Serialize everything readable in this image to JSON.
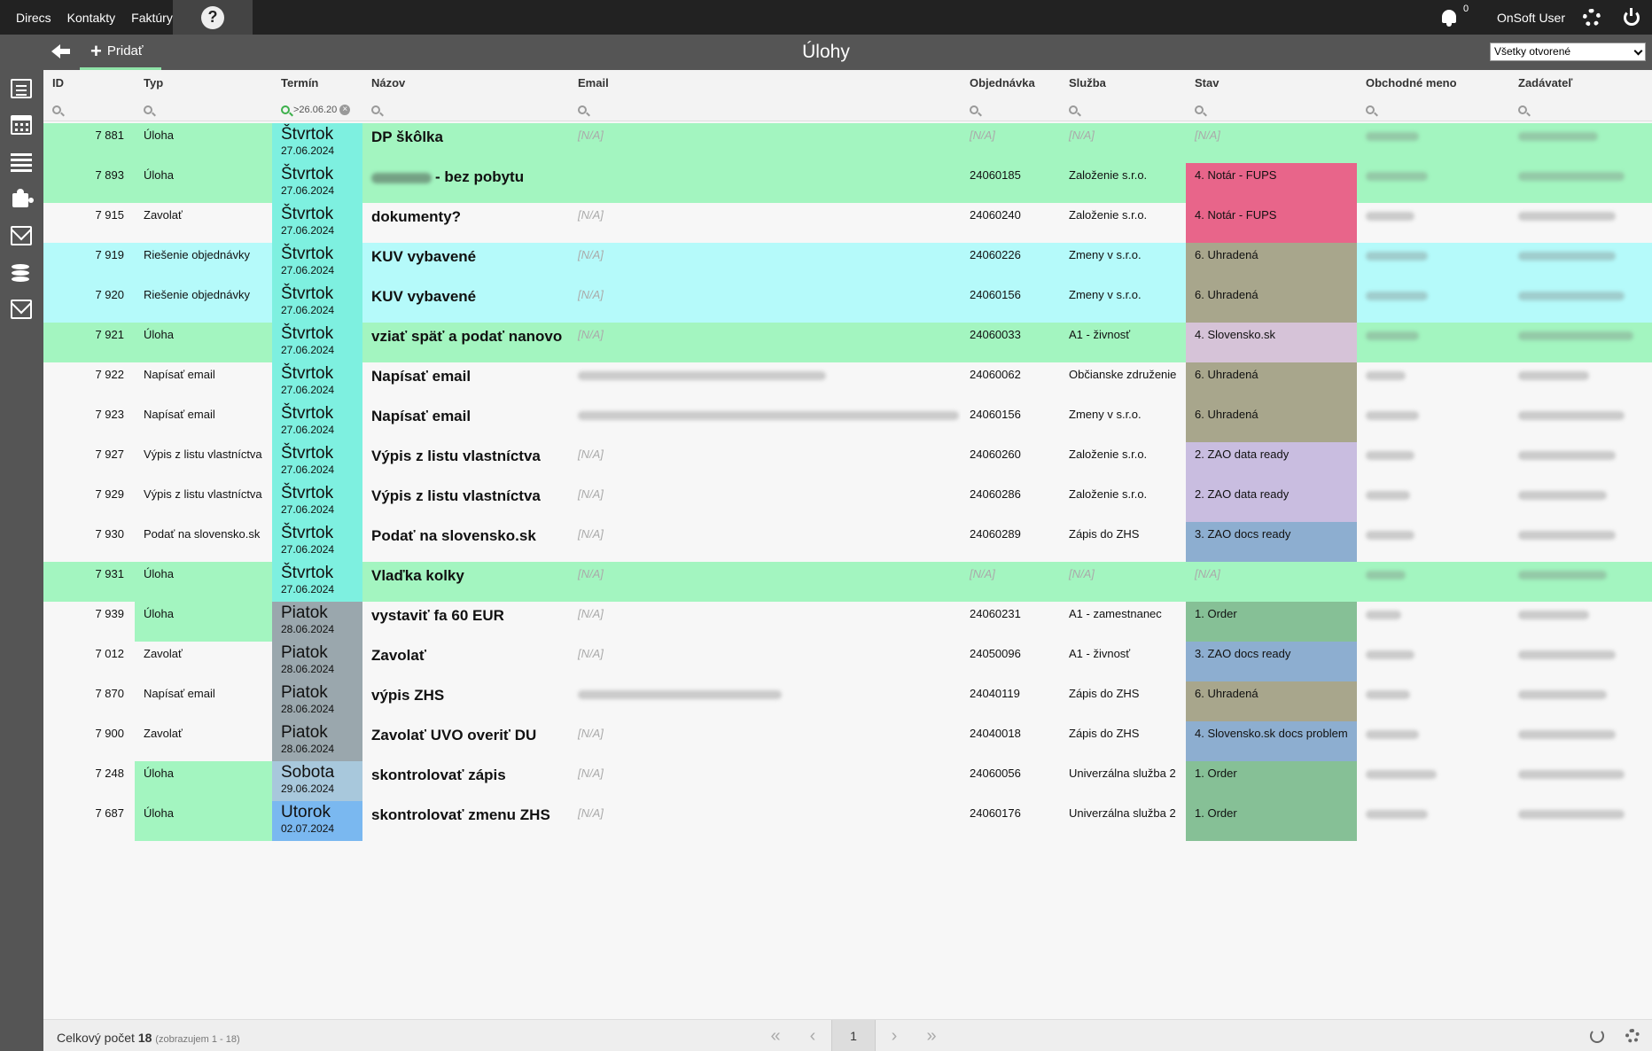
{
  "nav": [
    "Direcs",
    "Kontakty",
    "Faktúry"
  ],
  "help_label": "?",
  "notifications_count": "0",
  "user_name": "OnSoft User",
  "toolbar": {
    "add_label": "Pridať"
  },
  "page_title": "Úlohy",
  "view_filter": "Všetky otvorené",
  "columns": [
    "ID",
    "Typ",
    "Termín",
    "Názov",
    "Email",
    "Objednávka",
    "Služba",
    "Stav",
    "Obchodné meno",
    "Zadávateľ"
  ],
  "term_filter_value": ">26.06.20",
  "rows": [
    {
      "id": "7 881",
      "typ": "Úloha",
      "day": "Štvrtok",
      "date": "27.06.2024",
      "nazov": "DP škôlka",
      "email": "[N/A]",
      "obj": "[N/A]",
      "sluzba": "[N/A]",
      "stav": "[N/A]"
    },
    {
      "id": "7 893",
      "typ": "Úloha",
      "day": "Štvrtok",
      "date": "27.06.2024",
      "nazov": "- bez pobytu",
      "email": "",
      "obj": "24060185",
      "sluzba": "Založenie s.r.o.",
      "stav": "4. Notár - FUPS"
    },
    {
      "id": "7 915",
      "typ": "Zavolať",
      "day": "Štvrtok",
      "date": "27.06.2024",
      "nazov": "dokumenty?",
      "email": "[N/A]",
      "obj": "24060240",
      "sluzba": "Založenie s.r.o.",
      "stav": "4. Notár - FUPS"
    },
    {
      "id": "7 919",
      "typ": "Riešenie objednávky",
      "day": "Štvrtok",
      "date": "27.06.2024",
      "nazov": "KUV vybavené",
      "email": "[N/A]",
      "obj": "24060226",
      "sluzba": "Zmeny v s.r.o.",
      "stav": "6. Uhradená"
    },
    {
      "id": "7 920",
      "typ": "Riešenie objednávky",
      "day": "Štvrtok",
      "date": "27.06.2024",
      "nazov": "KUV vybavené",
      "email": "[N/A]",
      "obj": "24060156",
      "sluzba": "Zmeny v s.r.o.",
      "stav": "6. Uhradená"
    },
    {
      "id": "7 921",
      "typ": "Úloha",
      "day": "Štvrtok",
      "date": "27.06.2024",
      "nazov": "vziať späť a podať nanovo",
      "email": "[N/A]",
      "obj": "24060033",
      "sluzba": "A1 - živnosť",
      "stav": "4. Slovensko.sk"
    },
    {
      "id": "7 922",
      "typ": "Napísať email",
      "day": "Štvrtok",
      "date": "27.06.2024",
      "nazov": "Napísať email",
      "email": "",
      "obj": "24060062",
      "sluzba": "Občianske združenie",
      "stav": "6. Uhradená"
    },
    {
      "id": "7 923",
      "typ": "Napísať email",
      "day": "Štvrtok",
      "date": "27.06.2024",
      "nazov": "Napísať email",
      "email": "",
      "obj": "24060156",
      "sluzba": "Zmeny v s.r.o.",
      "stav": "6. Uhradená"
    },
    {
      "id": "7 927",
      "typ": "Výpis z listu vlastníctva",
      "day": "Štvrtok",
      "date": "27.06.2024",
      "nazov": "Výpis z listu vlastníctva",
      "email": "[N/A]",
      "obj": "24060260",
      "sluzba": "Založenie s.r.o.",
      "stav": "2. ZAO data ready"
    },
    {
      "id": "7 929",
      "typ": "Výpis z listu vlastníctva",
      "day": "Štvrtok",
      "date": "27.06.2024",
      "nazov": "Výpis z listu vlastníctva",
      "email": "[N/A]",
      "obj": "24060286",
      "sluzba": "Založenie s.r.o.",
      "stav": "2. ZAO data ready"
    },
    {
      "id": "7 930",
      "typ": "Podať na slovensko.sk",
      "day": "Štvrtok",
      "date": "27.06.2024",
      "nazov": "Podať na slovensko.sk",
      "email": "[N/A]",
      "obj": "24060289",
      "sluzba": "Zápis do ZHS",
      "stav": "3. ZAO docs ready"
    },
    {
      "id": "7 931",
      "typ": "Úloha",
      "day": "Štvrtok",
      "date": "27.06.2024",
      "nazov": "Vlaďka kolky",
      "email": "[N/A]",
      "obj": "[N/A]",
      "sluzba": "[N/A]",
      "stav": "[N/A]"
    },
    {
      "id": "7 939",
      "typ": "Úloha",
      "day": "Piatok",
      "date": "28.06.2024",
      "nazov": "vystaviť fa 60 EUR",
      "email": "[N/A]",
      "obj": "24060231",
      "sluzba": "A1 - zamestnanec",
      "stav": "1. Order"
    },
    {
      "id": "7 012",
      "typ": "Zavolať",
      "day": "Piatok",
      "date": "28.06.2024",
      "nazov": "Zavolať",
      "email": "[N/A]",
      "obj": "24050096",
      "sluzba": "A1 - živnosť",
      "stav": "3. ZAO docs ready"
    },
    {
      "id": "7 870",
      "typ": "Napísať email",
      "day": "Piatok",
      "date": "28.06.2024",
      "nazov": "výpis ZHS",
      "email": "",
      "obj": "24040119",
      "sluzba": "Zápis do ZHS",
      "stav": "6. Uhradená"
    },
    {
      "id": "7 900",
      "typ": "Zavolať",
      "day": "Piatok",
      "date": "28.06.2024",
      "nazov": "Zavolať UVO overiť DU",
      "email": "[N/A]",
      "obj": "24040018",
      "sluzba": "Zápis do ZHS",
      "stav": "4. Slovensko.sk docs problem"
    },
    {
      "id": "7 248",
      "typ": "Úloha",
      "day": "Sobota",
      "date": "29.06.2024",
      "nazov": "skontrolovať zápis",
      "email": "[N/A]",
      "obj": "24060056",
      "sluzba": "Univerzálna služba 2",
      "stav": "1. Order"
    },
    {
      "id": "7 687",
      "typ": "Úloha",
      "day": "Utorok",
      "date": "02.07.2024",
      "nazov": "skontrolovať zmenu ZHS",
      "email": "[N/A]",
      "obj": "24060176",
      "sluzba": "Univerzálna služba 2",
      "stav": "1. Order"
    }
  ],
  "colors": {
    "green": "#a3f5c0",
    "cyan": "#b5fafa",
    "white": "#f7f7f7",
    "term_cyan": "#7ef0e0",
    "term_gray": "#9aa7ad",
    "term_lightblue": "#a8c8dc",
    "term_blue": "#7ab8f0",
    "stav_notar": "#e8658a",
    "stav_uhradena": "#a8a68c",
    "stav_slovensko": "#d6c3d8",
    "stav_zao_data": "#c9bde0",
    "stav_zao_docs": "#8daed0",
    "stav_order": "#86c096"
  },
  "footer": {
    "total_label": "Celkový počet",
    "total_count": "18",
    "shown": "(zobrazujem 1 - 18)",
    "page": "1"
  }
}
